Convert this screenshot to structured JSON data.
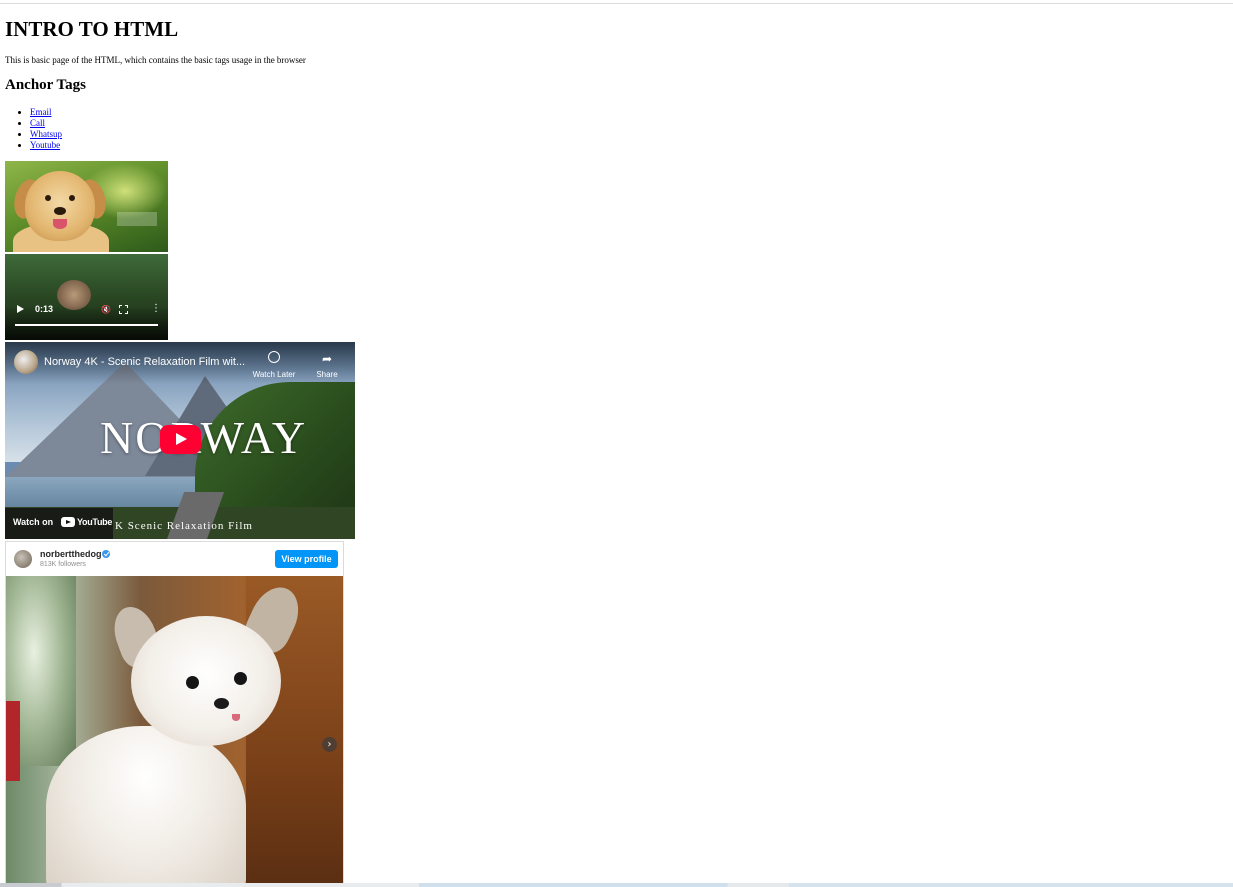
{
  "page": {
    "heading": "INTRO TO HTML",
    "description": "This is basic page of the HTML, which contains the basic tags usage in the browser",
    "anchor_heading": "Anchor Tags",
    "links": [
      {
        "label": "Email"
      },
      {
        "label": "Call"
      },
      {
        "label": "Whatsup"
      },
      {
        "label": "Youtube"
      }
    ]
  },
  "image": {
    "icon": "golden-retriever-photo"
  },
  "video": {
    "current_time": "0:13",
    "play_icon": "play-icon",
    "mute_icon": "mute-icon",
    "fullscreen_icon": "fullscreen-icon",
    "more_icon": "more-vert-icon",
    "more_glyph": "⋮",
    "mute_glyph": "🔇"
  },
  "youtube": {
    "title": "Norway 4K - Scenic Relaxation Film wit...",
    "watch_later": "Watch Later",
    "share": "Share",
    "share_glyph": "➦",
    "thumbnail_title": "NORWAY",
    "thumbnail_subtitle": "K Scenic Relaxation Film",
    "watch_on": "Watch on",
    "youtube_logo": "YouTube",
    "play_color": "#ff0033"
  },
  "instagram": {
    "username": "norbertthedog",
    "followers": "813K followers",
    "view_profile": "View profile",
    "next_glyph": "›",
    "accent": "#0095f6"
  }
}
